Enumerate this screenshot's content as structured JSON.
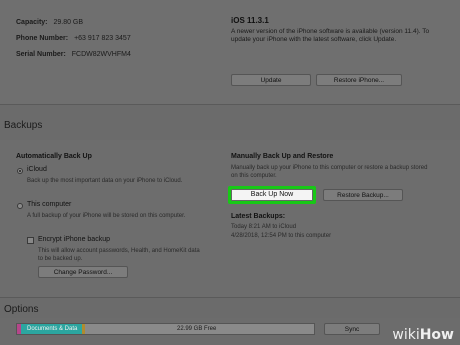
{
  "device": {
    "capacity_label": "Capacity:",
    "capacity_value": "29.80 GB",
    "phone_label": "Phone Number:",
    "phone_value": "+63 917 823 3457",
    "serial_label": "Serial Number:",
    "serial_value": "FCDW82WVHFM4"
  },
  "software": {
    "version": "iOS 11.3.1",
    "description": "A newer version of the iPhone software is available (version 11.4). To update your iPhone with the latest software, click Update.",
    "update_label": "Update",
    "restore_label": "Restore iPhone..."
  },
  "backups": {
    "title": "Backups",
    "auto_heading": "Automatically Back Up",
    "icloud_label": "iCloud",
    "icloud_desc": "Back up the most important data on your iPhone to iCloud.",
    "computer_label": "This computer",
    "computer_desc": "A full backup of your iPhone will be stored on this computer.",
    "encrypt_label": "Encrypt iPhone backup",
    "encrypt_desc": "This will allow account passwords, Health, and HomeKit data to be backed up.",
    "change_password_label": "Change Password...",
    "manual_heading": "Manually Back Up and Restore",
    "manual_desc": "Manually back up your iPhone to this computer or restore a backup stored on this computer.",
    "backup_now_label": "Back Up Now",
    "restore_backup_label": "Restore Backup...",
    "latest_heading": "Latest Backups:",
    "latest_line1": "Today 8:21 AM to iCloud",
    "latest_line2": "4/28/2018, 12:54 PM to this computer"
  },
  "options": {
    "title": "Options",
    "storage_label": "Documents & Data",
    "free_label": "22.99 GB Free",
    "sync_label": "Sync"
  },
  "watermark": {
    "wiki": "wiki",
    "how": "How"
  },
  "colors": {
    "highlight": "#17c916"
  }
}
